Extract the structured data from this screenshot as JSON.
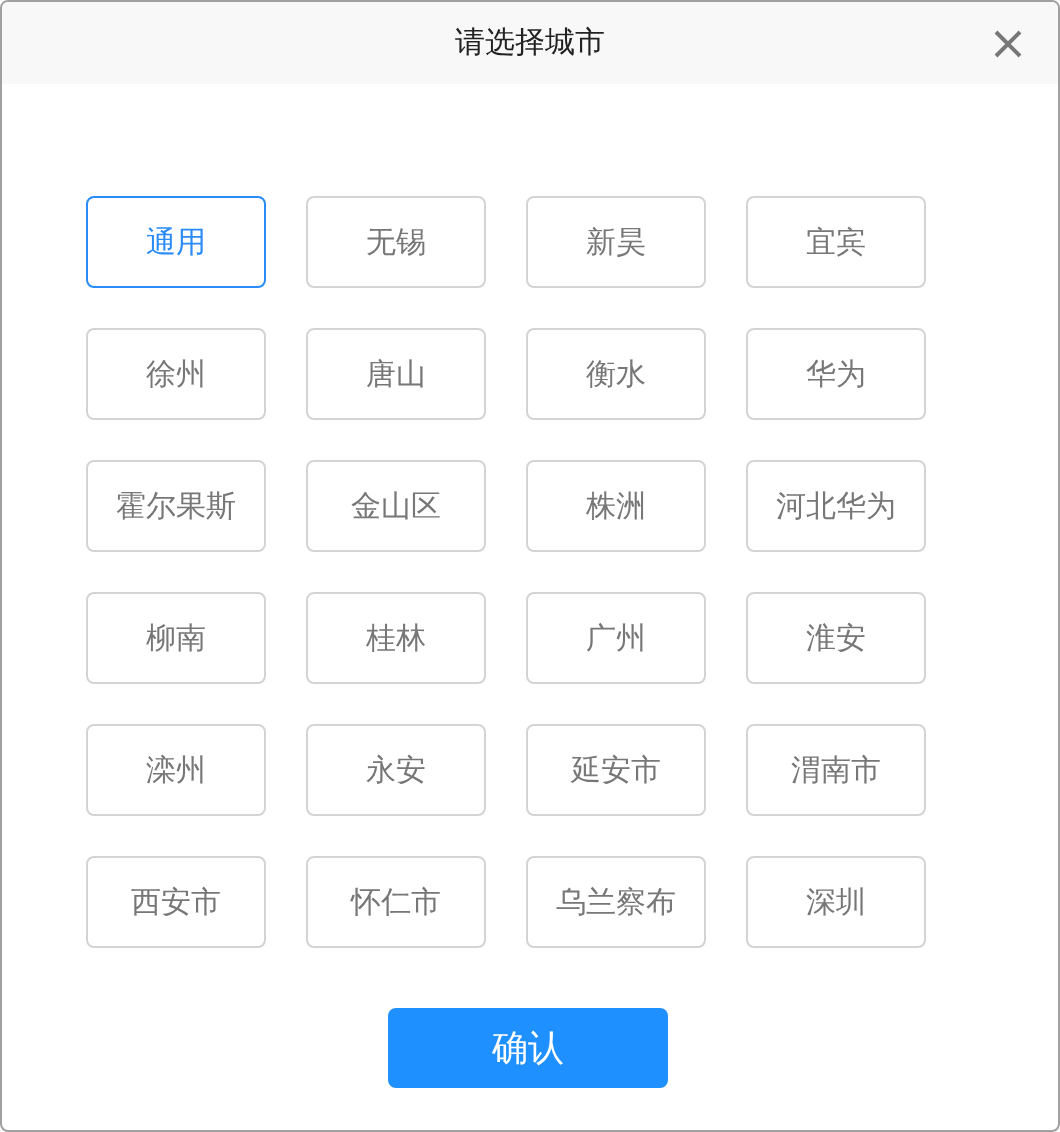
{
  "window": {
    "title": "请选择城市"
  },
  "cities": [
    {
      "label": "通用",
      "selected": true
    },
    {
      "label": "无锡",
      "selected": false
    },
    {
      "label": "新昊",
      "selected": false
    },
    {
      "label": "宜宾",
      "selected": false
    },
    {
      "label": "徐州",
      "selected": false
    },
    {
      "label": "唐山",
      "selected": false
    },
    {
      "label": "衡水",
      "selected": false
    },
    {
      "label": "华为",
      "selected": false
    },
    {
      "label": "霍尔果斯",
      "selected": false
    },
    {
      "label": "金山区",
      "selected": false
    },
    {
      "label": "株洲",
      "selected": false
    },
    {
      "label": "河北华为",
      "selected": false
    },
    {
      "label": "柳南",
      "selected": false
    },
    {
      "label": "桂林",
      "selected": false
    },
    {
      "label": "广州",
      "selected": false
    },
    {
      "label": "淮安",
      "selected": false
    },
    {
      "label": "滦州",
      "selected": false
    },
    {
      "label": "永安",
      "selected": false
    },
    {
      "label": "延安市",
      "selected": false
    },
    {
      "label": "渭南市",
      "selected": false
    },
    {
      "label": "西安市",
      "selected": false
    },
    {
      "label": "怀仁市",
      "selected": false
    },
    {
      "label": "乌兰察布",
      "selected": false
    },
    {
      "label": "深圳",
      "selected": false
    }
  ],
  "confirm_button": "确认"
}
